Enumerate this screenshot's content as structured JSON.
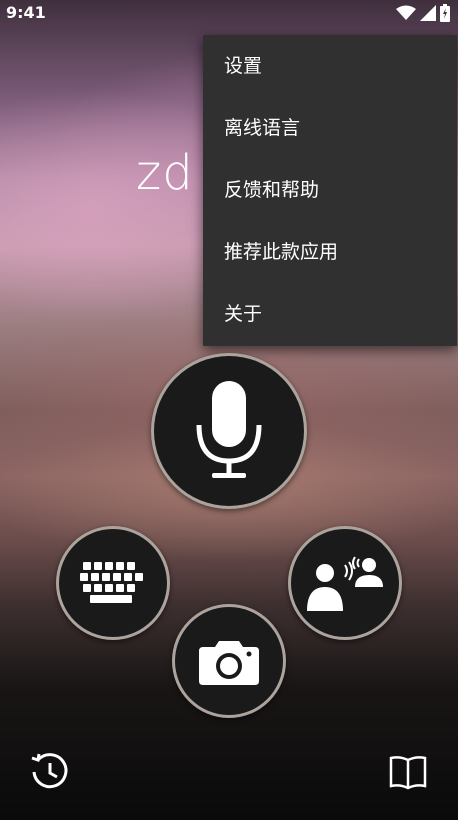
{
  "status_bar": {
    "time": "9:41",
    "icons": [
      "wifi-icon",
      "signal-icon",
      "battery-icon"
    ]
  },
  "main": {
    "detected_text": "zd"
  },
  "menu": {
    "items": [
      {
        "label": "设置"
      },
      {
        "label": "离线语言"
      },
      {
        "label": "反馈和帮助"
      },
      {
        "label": "推荐此款应用"
      },
      {
        "label": "关于"
      }
    ]
  },
  "buttons": {
    "microphone": "microphone-icon",
    "keyboard": "keyboard-icon",
    "camera": "camera-icon",
    "conversation": "conversation-icon"
  },
  "bottom_bar": {
    "left": "history-icon",
    "right": "phrasebook-icon"
  },
  "colors": {
    "menu_background": "#303030",
    "button_background": "#1a1a1a"
  }
}
